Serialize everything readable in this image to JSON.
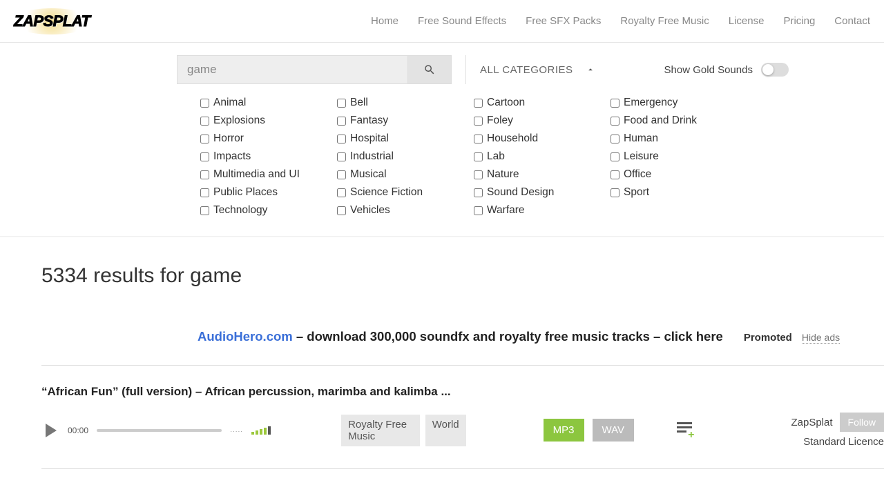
{
  "brand": "ZAPSPLAT",
  "nav": {
    "home": "Home",
    "free_sfx": "Free Sound Effects",
    "free_packs": "Free SFX Packs",
    "royalty_music": "Royalty Free Music",
    "license": "License",
    "pricing": "Pricing",
    "contact": "Contact"
  },
  "search": {
    "value": "game",
    "categories_label": "ALL CATEGORIES",
    "gold_label": "Show Gold Sounds"
  },
  "categories": [
    "Animal",
    "Bell",
    "Cartoon",
    "Emergency",
    "Explosions",
    "Fantasy",
    "Foley",
    "Food and Drink",
    "Horror",
    "Hospital",
    "Household",
    "Human",
    "Impacts",
    "Industrial",
    "Lab",
    "Leisure",
    "Multimedia and UI",
    "Musical",
    "Nature",
    "Office",
    "Public Places",
    "Science Fiction",
    "Sound Design",
    "Sport",
    "Technology",
    "Vehicles",
    "Warfare"
  ],
  "results": {
    "heading": "5334 results for game"
  },
  "promo": {
    "link_text": "AudioHero.com",
    "rest": " – download 300,000 soundfx and royalty free music tracks – click here",
    "promoted": "Promoted",
    "hide": "Hide ads"
  },
  "sound": {
    "title": "“African Fun” (full version) – African percussion, marimba and kalimba ...",
    "time": "00:00",
    "dots": ".....",
    "tags": [
      "Royalty Free Music",
      "World"
    ],
    "mp3": "MP3",
    "wav": "WAV",
    "author": "ZapSplat",
    "follow": "Follow",
    "licence": "Standard Licence"
  }
}
